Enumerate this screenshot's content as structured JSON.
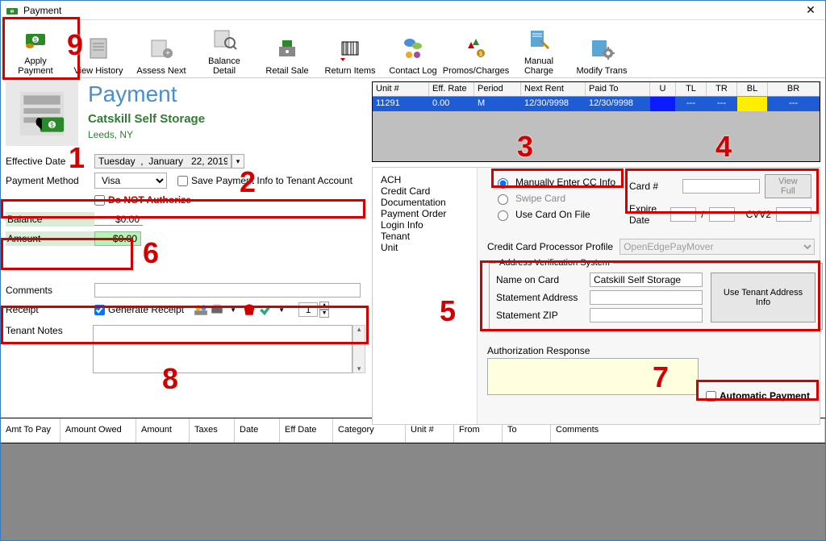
{
  "window": {
    "title": "Payment",
    "close_glyph": "✕"
  },
  "toolbar": [
    {
      "name": "apply-payment",
      "label": "Apply Payment"
    },
    {
      "name": "view-history",
      "label": "View History"
    },
    {
      "name": "assess-next",
      "label": "Assess Next"
    },
    {
      "name": "balance-detail",
      "label": "Balance Detail"
    },
    {
      "name": "retail-sale",
      "label": "Retail Sale"
    },
    {
      "name": "return-items",
      "label": "Return Items"
    },
    {
      "name": "contact-log",
      "label": "Contact Log"
    },
    {
      "name": "promos-charges",
      "label": "Promos/Charges"
    },
    {
      "name": "manual-charge",
      "label": "Manual Charge"
    },
    {
      "name": "modify-trans",
      "label": "Modify Trans"
    }
  ],
  "heading": "Payment",
  "tenant": {
    "name": "Catskill Self Storage",
    "location": "Leeds, NY"
  },
  "effective": {
    "label": "Effective Date",
    "value": "Tuesday  ,  January   22, 2019"
  },
  "payment_method": {
    "label": "Payment Method",
    "value": "Visa"
  },
  "save_info": {
    "label": "Save Payment Info to Tenant Account"
  },
  "do_not_auth": {
    "label": "Do NOT Authorize"
  },
  "balance": {
    "label": "Balance",
    "value": "$0.00"
  },
  "amount": {
    "label": "Amount",
    "value": "$0.00"
  },
  "comments": {
    "label": "Comments",
    "value": ""
  },
  "receipt": {
    "label": "Receipt",
    "gen_label": "Generate Receipt",
    "copies": "1"
  },
  "tenant_notes": {
    "label": "Tenant Notes",
    "value": ""
  },
  "unit_grid": {
    "headers": [
      "Unit #",
      "Eff. Rate",
      "Period",
      "Next Rent",
      "Paid To",
      "U",
      "TL",
      "TR",
      "BL",
      "BR"
    ],
    "row": {
      "unit": "11291",
      "rate": "0.00",
      "period": "M",
      "next_rent": "12/30/9998",
      "paid_to": "12/30/9998",
      "u": "",
      "tl": "---",
      "tr": "---",
      "bl": "",
      "br": "---"
    },
    "row_colors": {
      "row_bg": "#1e5cd6",
      "row_fg": "#ffffff",
      "u": "#0a1cff",
      "tl": "#1e5cd6",
      "tr": "#1e5cd6",
      "bl": "#ffee00",
      "br": "#1e5cd6"
    }
  },
  "detail_tabs": [
    "ACH",
    "Credit Card",
    "Documentation",
    "Payment Order",
    "Login Info",
    "Tenant",
    "Unit"
  ],
  "cc_entry": {
    "manual": "Manually Enter CC Info",
    "swipe": "Swipe  Card",
    "on_file": "Use Card On File"
  },
  "card": {
    "card_num_label": "Card #",
    "view_full": "View Full",
    "exp_label": "Expire Date",
    "slash": "/",
    "cvv_label": "CVV2"
  },
  "ccpp": {
    "label": "Credit Card Processor Profile",
    "value": "OpenEdgePayMover"
  },
  "avs": {
    "legend": "Address Verification System",
    "name_label": "Name on Card",
    "name_value": "Catskill Self Storage",
    "addr_label": "Statement Address",
    "addr_value": "",
    "zip_label": "Statement ZIP",
    "zip_value": "",
    "btn": "Use Tenant Address Info"
  },
  "auth_resp": {
    "label": "Authorization Response"
  },
  "auto_pay": {
    "label": "Automatic Payment"
  },
  "lower_headers": [
    "Amt To Pay",
    "Amount Owed",
    "Amount",
    "Taxes",
    "Date",
    "Eff Date",
    "Category",
    "Unit #",
    "From",
    "To",
    "Comments"
  ],
  "annotations": {
    "1": "1",
    "2": "2",
    "3": "3",
    "4": "4",
    "5": "5",
    "6": "6",
    "7": "7",
    "8": "8",
    "9": "9"
  }
}
